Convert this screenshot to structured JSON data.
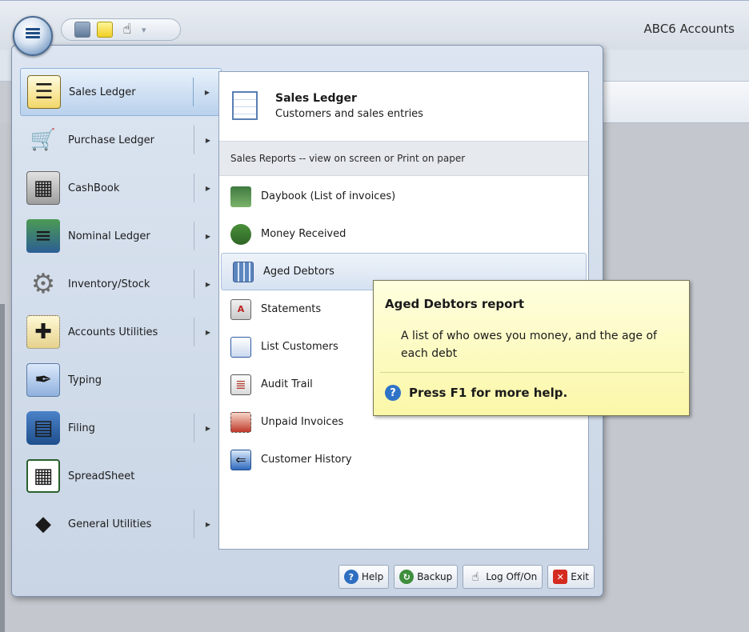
{
  "window": {
    "app_title": "ABC6 Accounts"
  },
  "quick_access": {
    "icons": [
      "calculator-icon",
      "sticky-note-icon",
      "hand-pointer-icon"
    ]
  },
  "left_menu": {
    "items": [
      {
        "label": "Sales Ledger",
        "icon": "ledger-card-icon",
        "has_submenu": true,
        "active": true
      },
      {
        "label": "Purchase Ledger",
        "icon": "shopping-cart-icon",
        "has_submenu": true
      },
      {
        "label": "CashBook",
        "icon": "cash-register-icon",
        "has_submenu": true
      },
      {
        "label": "Nominal Ledger",
        "icon": "books-icon",
        "has_submenu": true
      },
      {
        "label": "Inventory/Stock",
        "icon": "gear-icon",
        "has_submenu": true
      },
      {
        "label": "Accounts Utilities",
        "icon": "utilities-icon",
        "has_submenu": true
      },
      {
        "label": "Typing",
        "icon": "pen-icon",
        "has_submenu": false
      },
      {
        "label": "Filing",
        "icon": "filing-cabinet-icon",
        "has_submenu": true
      },
      {
        "label": "SpreadSheet",
        "icon": "spreadsheet-icon",
        "has_submenu": false
      },
      {
        "label": "General Utilities",
        "icon": "shapes-icon",
        "has_submenu": true
      }
    ]
  },
  "right_pane": {
    "header_title": "Sales Ledger",
    "header_subtitle": "Customers and sales entries",
    "section_label": "Sales Reports -- view on screen or Print on paper",
    "items": [
      {
        "label": "Daybook (List of invoices)",
        "icon": "open-book-icon"
      },
      {
        "label": "Money Received",
        "icon": "money-icon"
      },
      {
        "label": "Aged Debtors",
        "icon": "aged-debtors-icon",
        "hover": true
      },
      {
        "label": "Statements",
        "icon": "statement-icon"
      },
      {
        "label": "List Customers",
        "icon": "list-customers-icon"
      },
      {
        "label": "Audit Trail",
        "icon": "audit-trail-icon"
      },
      {
        "label": "Unpaid Invoices",
        "icon": "unpaid-invoice-icon"
      },
      {
        "label": "Customer History",
        "icon": "customer-history-icon"
      }
    ]
  },
  "footer": {
    "help": "Help",
    "backup": "Backup",
    "logoff": "Log Off/On",
    "exit": "Exit"
  },
  "tooltip": {
    "title": "Aged Debtors report",
    "body": "A list of who owes you money, and the age of each debt",
    "help_text": "Press F1 for more help."
  }
}
